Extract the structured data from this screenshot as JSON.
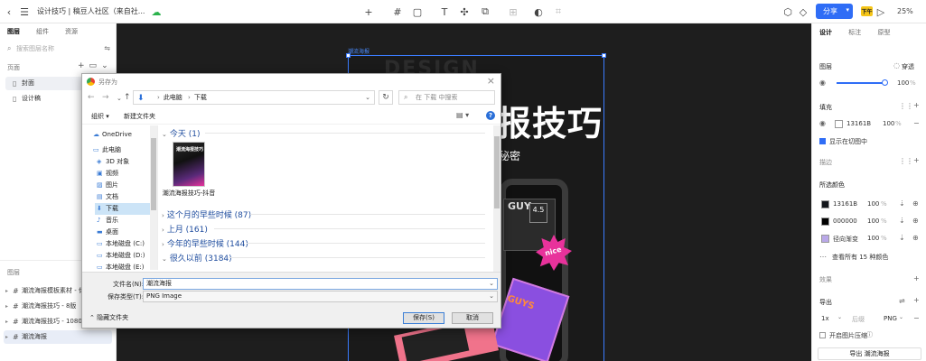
{
  "toolbar": {
    "title": "设计技巧 | 稿豆人社区（来自社...",
    "share_label": "分享",
    "pro_label": "下午",
    "zoom": "25%"
  },
  "left": {
    "tabs": [
      "图层",
      "组件",
      "资源"
    ],
    "search_placeholder": "搜索图层名称",
    "pages_heading": "页面",
    "pages": [
      "封面",
      "设计稿"
    ],
    "layers_heading": "图层",
    "layers": [
      "潮流海报模板素材 - 你...",
      "潮流海报技巧 - 8版",
      "潮流海报技巧 - 1080...",
      "潮流海报"
    ]
  },
  "canvas": {
    "frame_label": "潮流海报",
    "ghost": "DESIGN",
    "title": "报技巧",
    "subtitle": "秘密",
    "guy": "GUY",
    "num": "4.5",
    "nice": "nice",
    "guys": "GUYS"
  },
  "dialog": {
    "title": "另存为",
    "path": [
      "此电脑",
      "下载"
    ],
    "search_placeholder": "在 下载 中搜索",
    "organize": "组织 ▾",
    "new_folder": "新建文件夹",
    "tree": [
      "OneDrive",
      "此电脑",
      "3D 对象",
      "视频",
      "图片",
      "文档",
      "下载",
      "音乐",
      "桌面",
      "本地磁盘 (C:)",
      "本地磁盘 (D:)",
      "本地磁盘 (E:)"
    ],
    "groups": {
      "today": "今天 (1)",
      "earlier_month": "这个月的早些时候 (87)",
      "last_month": "上月 (161)",
      "earlier_year": "今年的早些时候 (144)",
      "long_ago": "很久以前 (3184)"
    },
    "file": {
      "thumb_text": "潮流海报技巧",
      "caption": "潮流海报技巧-抖音"
    },
    "filename_label": "文件名(N):",
    "filename": "潮流海报",
    "filetype_label": "保存类型(T):",
    "filetype": "PNG Image",
    "hide_folders": "隐藏文件夹",
    "save": "保存(S)",
    "cancel": "取消"
  },
  "right": {
    "tabs": [
      "设计",
      "标注",
      "原型"
    ],
    "layer_heading": "图层",
    "blend": "穿透",
    "opacity": "100",
    "pct": "%",
    "fill_heading": "填充",
    "fill_hex": "13161B",
    "fill_opacity": "100",
    "show_in_view": "显示在切图中",
    "stroke_heading": "描边",
    "selected_colors_heading": "所选颜色",
    "colors": [
      {
        "hex": "13161B",
        "opacity": "100",
        "swatch": "#13161b"
      },
      {
        "hex": "000000",
        "opacity": "100",
        "swatch": "#000000"
      },
      {
        "hex": "径向渐变",
        "opacity": "100",
        "swatch": "#b9a8e8"
      }
    ],
    "see_all": "查看所有 15 种颜色",
    "effects_heading": "效果",
    "export_heading": "导出",
    "export_scale": "1x",
    "export_suffix": "后缀",
    "export_format": "PNG",
    "compress_label": "开启图片压缩",
    "export_button": "导出 潮流海报"
  }
}
